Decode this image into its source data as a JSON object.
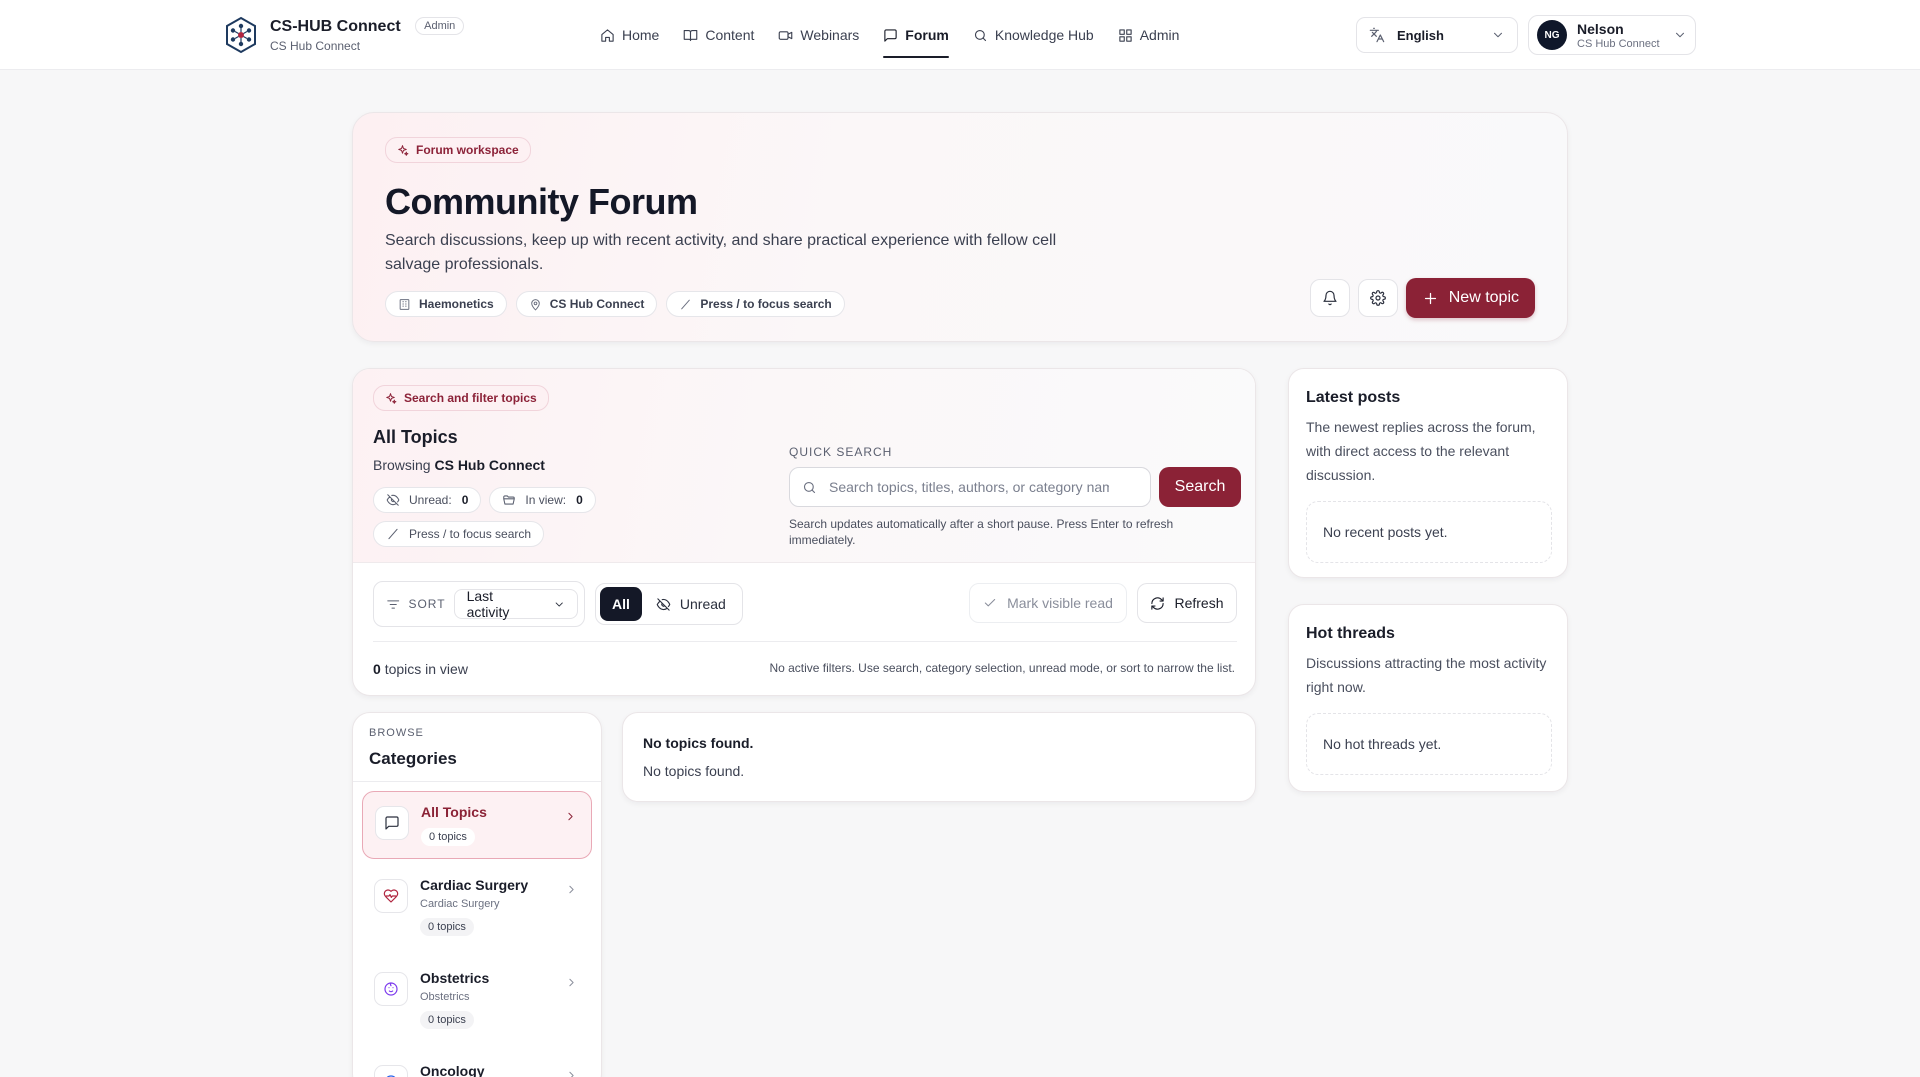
{
  "brand": {
    "name": "CS-HUB Connect",
    "badge": "Admin",
    "subtitle": "CS Hub Connect",
    "logo_icon": "hex-network-logo"
  },
  "nav": {
    "items": [
      {
        "label": "Home",
        "icon": "home-icon"
      },
      {
        "label": "Content",
        "icon": "book-icon"
      },
      {
        "label": "Webinars",
        "icon": "video-icon"
      },
      {
        "label": "Forum",
        "icon": "message-square-icon",
        "active": true
      },
      {
        "label": "Knowledge Hub",
        "icon": "search-icon"
      },
      {
        "label": "Admin",
        "icon": "grid-icon"
      }
    ]
  },
  "language": {
    "value": "English"
  },
  "user": {
    "initials": "NG",
    "name": "Nelson",
    "org": "CS Hub Connect"
  },
  "hero": {
    "tag": "Forum workspace",
    "title": "Community Forum",
    "description": "Search discussions, keep up with recent activity, and share practical experience with fellow cell salvage professionals.",
    "chips": [
      "Haemonetics",
      "CS Hub Connect",
      "Press / to focus search"
    ],
    "new_topic_label": "New topic"
  },
  "filter": {
    "tag": "Search and filter topics",
    "title": "All Topics",
    "browsing_prefix": "Browsing",
    "browsing_value": "CS Hub Connect",
    "unread_label": "Unread:",
    "unread_value": "0",
    "inview_label": "In view:",
    "inview_value": "0",
    "hint": "Press / to focus search",
    "quick_search_label": "QUICK SEARCH",
    "search_placeholder": "Search topics, titles, authors, or category names",
    "search_button": "Search",
    "search_help": "Search updates automatically after a short pause. Press Enter to refresh immediately.",
    "sort_label": "SORT",
    "sort_value": "Last activity",
    "seg_all": "All",
    "seg_unread": "Unread",
    "mark_read": "Mark visible read",
    "refresh": "Refresh",
    "topic_count": "0",
    "topic_count_suffix": "topics in view",
    "filters_note": "No active filters. Use search, category selection, unread mode, or sort to narrow the list."
  },
  "categories": {
    "kicker": "BROWSE",
    "title": "Categories",
    "items": [
      {
        "name": "All Topics",
        "sub": "",
        "count": "0 topics",
        "icon": "message-square-icon",
        "active": true
      },
      {
        "name": "Cardiac Surgery",
        "sub": "Cardiac Surgery",
        "count": "0 topics",
        "icon": "heart-pulse-icon",
        "color": "#b0253f"
      },
      {
        "name": "Obstetrics",
        "sub": "Obstetrics",
        "count": "0 topics",
        "icon": "baby-icon",
        "color": "#7c3aed"
      },
      {
        "name": "Oncology",
        "sub": "",
        "count": "",
        "icon": "ribbon-icon",
        "color": "#2563eb"
      }
    ]
  },
  "topics": {
    "empty_title": "No topics found.",
    "empty_sub": "No topics found."
  },
  "latest": {
    "title": "Latest posts",
    "description": "The newest replies across the forum, with direct access to the relevant discussion.",
    "empty": "No recent posts yet."
  },
  "hot": {
    "title": "Hot threads",
    "description": "Discussions attracting the most activity right now.",
    "empty": "No hot threads yet."
  },
  "colors": {
    "accent": "#8b2236",
    "dark": "#141827"
  }
}
